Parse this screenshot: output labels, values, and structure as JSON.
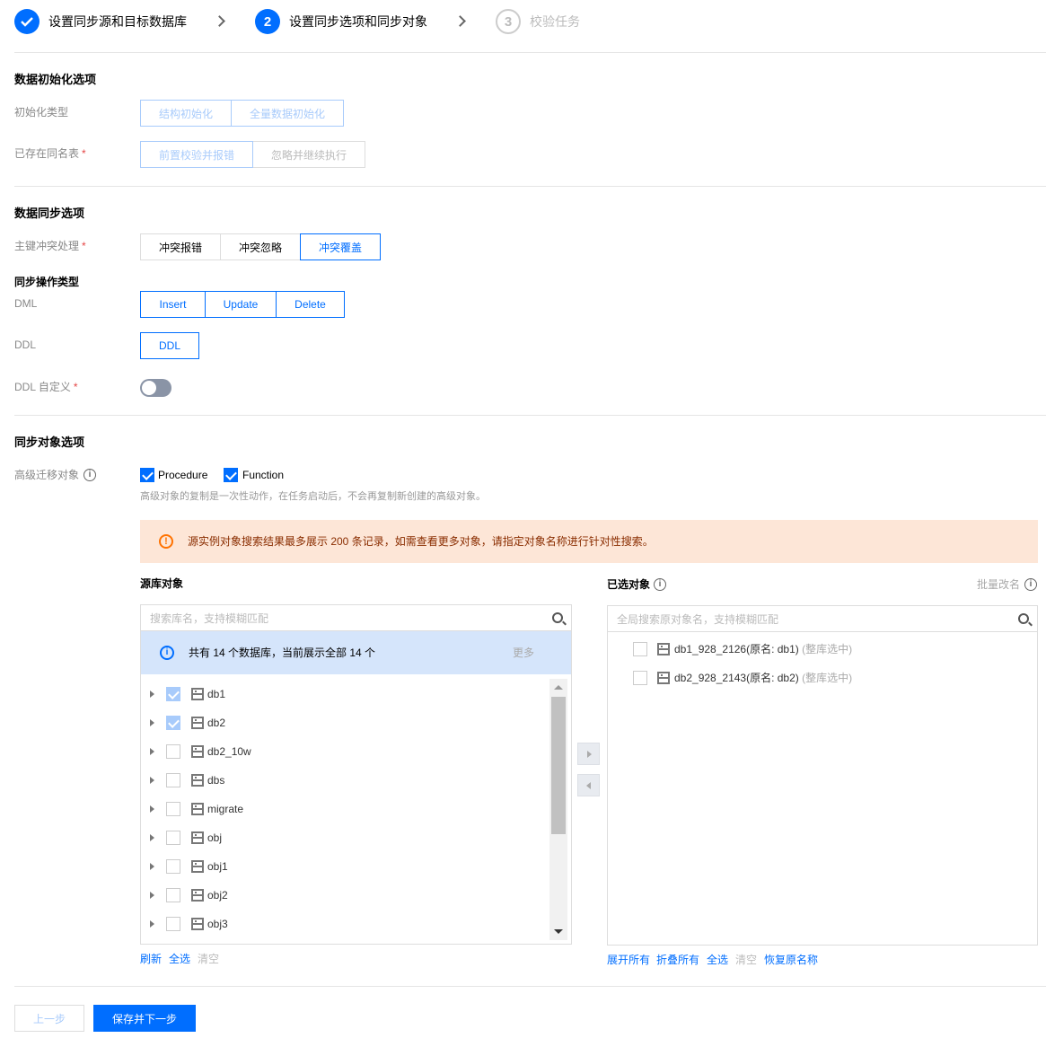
{
  "steps": [
    {
      "number": "1",
      "label": "设置同步源和目标数据库",
      "state": "done"
    },
    {
      "number": "2",
      "label": "设置同步选项和同步对象",
      "state": "active"
    },
    {
      "number": "3",
      "label": "校验任务",
      "state": "pending"
    }
  ],
  "init_section": {
    "title": "数据初始化选项",
    "init_type_label": "初始化类型",
    "init_type_options": [
      "结构初始化",
      "全量数据初始化"
    ],
    "existing_table_label": "已存在同名表",
    "existing_table_options": [
      "前置校验并报错",
      "忽略并继续执行"
    ]
  },
  "sync_section": {
    "title": "数据同步选项",
    "conflict_label": "主键冲突处理",
    "conflict_options": [
      "冲突报错",
      "冲突忽略",
      "冲突覆盖"
    ],
    "op_type_title": "同步操作类型",
    "dml_label": "DML",
    "dml_options": [
      "Insert",
      "Update",
      "Delete"
    ],
    "ddl_label": "DDL",
    "ddl_options": [
      "DDL"
    ],
    "ddl_custom_label": "DDL 自定义",
    "ddl_custom_enabled": false
  },
  "object_section": {
    "title": "同步对象选项",
    "advanced_label": "高级迁移对象",
    "advanced_options": [
      {
        "label": "Procedure",
        "checked": true
      },
      {
        "label": "Function",
        "checked": true
      }
    ],
    "advanced_hint": "高级对象的复制是一次性动作，在任务启动后，不会再复制新创建的高级对象。",
    "warning": "源实例对象搜索结果最多展示 200 条记录，如需查看更多对象，请指定对象名称进行针对性搜索。"
  },
  "source_panel": {
    "title": "源库对象",
    "search_placeholder": "搜索库名，支持模糊匹配",
    "info": "共有 14 个数据库，当前展示全部 14 个",
    "more": "更多",
    "items": [
      {
        "name": "db1",
        "checked": true
      },
      {
        "name": "db2",
        "checked": true
      },
      {
        "name": "db2_10w",
        "checked": false
      },
      {
        "name": "dbs",
        "checked": false
      },
      {
        "name": "migrate",
        "checked": false
      },
      {
        "name": "obj",
        "checked": false
      },
      {
        "name": "obj1",
        "checked": false
      },
      {
        "name": "obj2",
        "checked": false
      },
      {
        "name": "obj3",
        "checked": false
      }
    ],
    "links": [
      "刷新",
      "全选",
      "清空"
    ]
  },
  "selected_panel": {
    "title": "已选对象",
    "batch_rename": "批量改名",
    "search_placeholder": "全局搜索原对象名，支持模糊匹配",
    "items": [
      {
        "name": "db1_928_2126(原名: db1)",
        "note": "(整库选中)"
      },
      {
        "name": "db2_928_2143(原名: db2)",
        "note": "(整库选中)"
      }
    ],
    "links": [
      "展开所有",
      "折叠所有",
      "全选",
      "清空",
      "恢复原名称"
    ]
  },
  "footer": {
    "prev": "上一步",
    "next": "保存并下一步"
  }
}
